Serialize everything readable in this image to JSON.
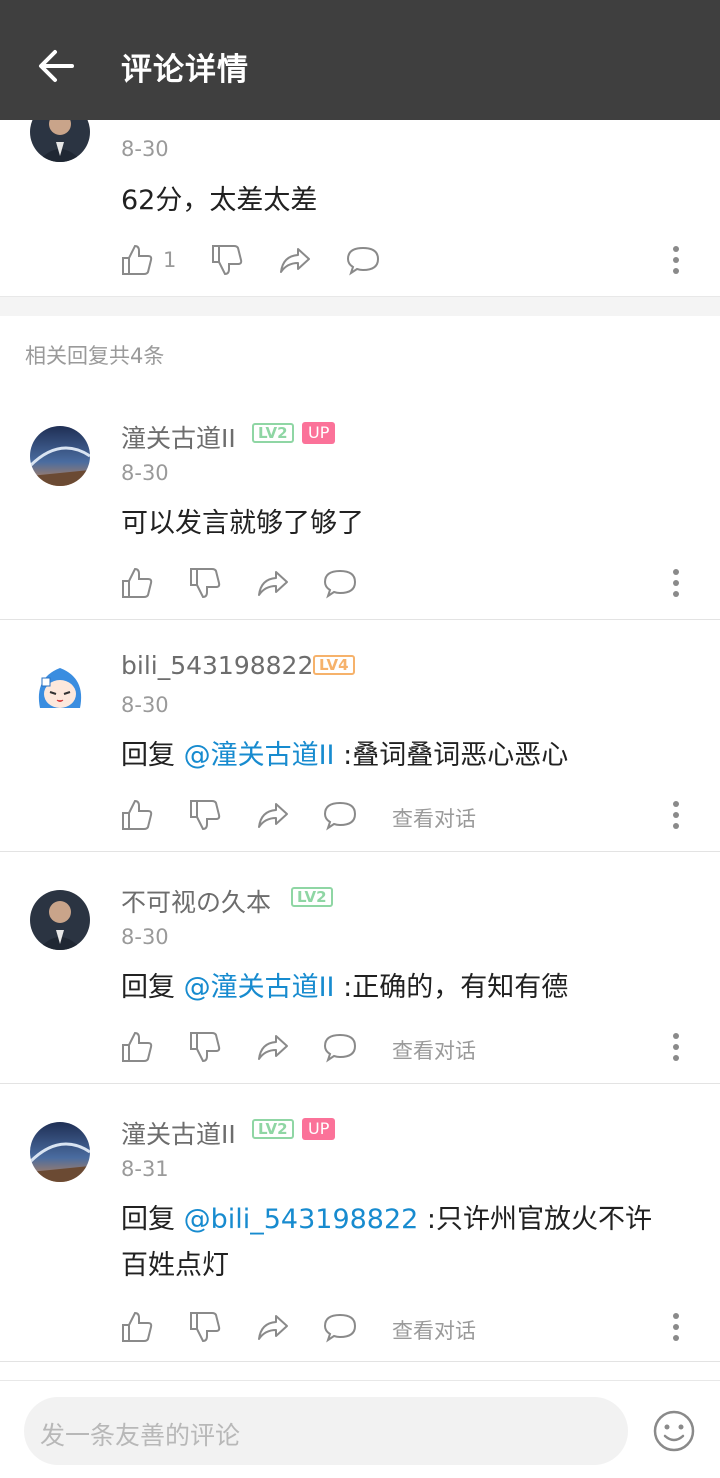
{
  "header": {
    "title": "评论详情"
  },
  "main": {
    "date": "8-30",
    "text": "62分，太差太差",
    "like_count": "1"
  },
  "section_title": "相关回复共4条",
  "replies": [
    {
      "username": "潼关古道II",
      "level": "LV2",
      "up": "UP",
      "date": "8-30",
      "prefix": "",
      "mention": "",
      "text": "可以发言就够了够了",
      "text2": "",
      "view": ""
    },
    {
      "username": "bili_543198822",
      "level": "LV4",
      "up": "",
      "date": "8-30",
      "prefix": "回复 ",
      "mention": "@潼关古道II",
      "text": " :叠词叠词恶心恶心",
      "text2": "",
      "view": "查看对话"
    },
    {
      "username": "不可视の久本",
      "level": "LV2",
      "up": "",
      "date": "8-30",
      "prefix": "回复 ",
      "mention": "@潼关古道II",
      "text": " :正确的，有知有德",
      "text2": "",
      "view": "查看对话"
    },
    {
      "username": "潼关古道II",
      "level": "LV2",
      "up": "UP",
      "date": "8-31",
      "prefix": "回复 ",
      "mention": "@bili_543198822",
      "text": " :只许州官放火不许",
      "text2": "百姓点灯",
      "view": "查看对话"
    }
  ],
  "input": {
    "placeholder": "发一条友善的评论"
  },
  "colors": {
    "header_bg": "#3f3f3f",
    "mention": "#178bcf",
    "up_badge": "#fb7299",
    "lv2": "#8fd6a4",
    "lv4": "#f6b26b"
  }
}
